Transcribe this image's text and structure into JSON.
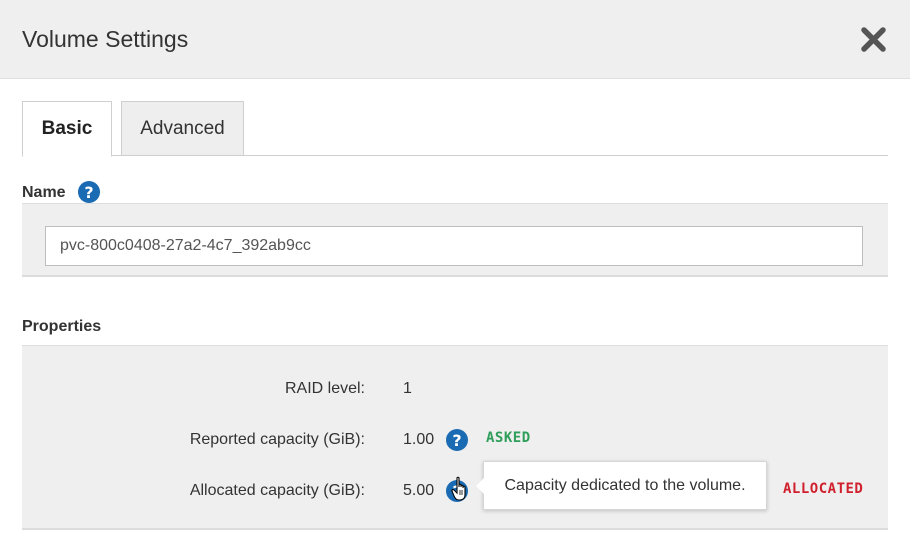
{
  "dialog": {
    "title": "Volume Settings"
  },
  "tabs": [
    {
      "label": "Basic",
      "active": true
    },
    {
      "label": "Advanced",
      "active": false
    }
  ],
  "name_section": {
    "label": "Name",
    "value": "pvc-800c0408-27a2-4c7_392ab9cc"
  },
  "properties": {
    "heading": "Properties",
    "rows": [
      {
        "label": "RAID level:",
        "value": "1"
      },
      {
        "label": "Reported capacity (GiB):",
        "value": "1.00",
        "badge": "ASKED"
      },
      {
        "label": "Allocated capacity (GiB):",
        "value": "5.00",
        "badge": "ALLOCATED"
      }
    ]
  },
  "tooltip": {
    "text": "Capacity dedicated to the volume."
  },
  "colors": {
    "help_icon": "#1a6bb3",
    "asked_badge": "#2e9e5b",
    "allocated_badge": "#d0202e"
  },
  "icons": {
    "close": "close-icon",
    "help": "question-circle-icon",
    "cursor": "hand-pointer-cursor-icon"
  }
}
